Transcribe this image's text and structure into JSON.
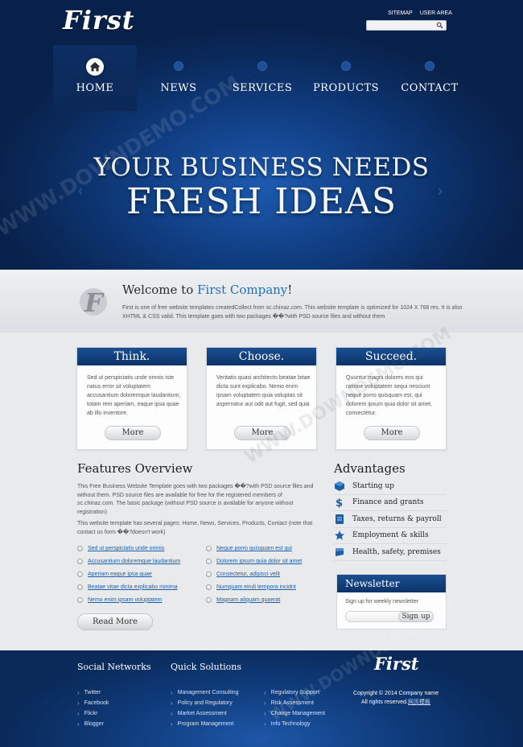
{
  "brand": {
    "logo": "First"
  },
  "toplinks": [
    "SITEMAP",
    "USER AREA"
  ],
  "search": {
    "placeholder": ""
  },
  "nav": [
    {
      "label": "HOME",
      "active": true,
      "icon": "home-icon"
    },
    {
      "label": "NEWS",
      "active": false,
      "icon": "news-icon"
    },
    {
      "label": "SERVICES",
      "active": false,
      "icon": "services-icon"
    },
    {
      "label": "PRODUCTS",
      "active": false,
      "icon": "products-icon"
    },
    {
      "label": "CONTACT",
      "active": false,
      "icon": "contact-icon"
    }
  ],
  "hero": {
    "line1": "YOUR BUSINESS NEEDS",
    "line2": "FRESH IDEAS",
    "prev": "‹",
    "next": "›"
  },
  "welcome": {
    "title_prefix": "Welcome to ",
    "title_accent": "First Company",
    "title_suffix": "!",
    "text": "First is one of free website templates createdCollect from sc.chinaz.com. This website template is optimized for 1024 X 768 res. It is also XHTML & CSS valid. This template goes with two packages ��?with PSD source files and without them"
  },
  "boxes": [
    {
      "title": "Think.",
      "text": "Sed ut perspiciatis unde omnis iste natus error sit voluptatem accusantium doloremque laudantium, totam rem aperiam, eaque ipsa quae ab illo inventore.",
      "button": "More"
    },
    {
      "title": "Choose.",
      "text": "Veritatis quasi architecto beatae bitae dicta sunt explicabo. Nemo enim ipsam voluptatem quia voluptas sit aspernatur aut odit aut fugit, sed quia",
      "button": "More"
    },
    {
      "title": "Succeed.",
      "text": "Quuntur magni dolores eos qui ratione voluptatem sequi nesciunt neque porro quisquam est, qui dolorem ipsum quia dolor sit amet, consectetur.",
      "button": "More"
    }
  ],
  "features": {
    "title": "Features Overview",
    "p1": "This Free Business Website Template goes with two packages ��?with PSD source files and without them. PSD source files are available for free for the registered members of sc.chinaz.com. The basic package (without PSD source is available for anyone without registration)",
    "p2": "This website template has several pages: Home, News, Services, Products, Contact (note that contact us form ��?doesn't work)",
    "list_left": [
      "Sed ut perspiciatis unde omnis",
      "Accusantium doloremque laudantium",
      "Aperiam eaque ipsa quae",
      "Beatae vitae dicta explicabo minima",
      "Nemo enim ipsam voluptatem"
    ],
    "list_right": [
      "Neque porro quisquam est qui",
      "Dolorem ipsum quia dolor sit amet",
      "Consectetur, adipisci velit",
      "Numquam eindi tempora incidnt",
      "Magnam aliquam quaerat"
    ],
    "button": "Read More"
  },
  "advantages": {
    "title": "Advantages",
    "items": [
      {
        "label": "Starting up",
        "icon": "cube-icon"
      },
      {
        "label": "Finance and grants",
        "icon": "dollar-icon"
      },
      {
        "label": "Taxes, returns & payroll",
        "icon": "receipt-icon"
      },
      {
        "label": "Employment & skills",
        "icon": "star-icon"
      },
      {
        "label": "Health, safety, premises",
        "icon": "flag-icon"
      }
    ]
  },
  "newsletter": {
    "title": "Newsletter",
    "text": "Sign up for weekly newsletter",
    "placeholder": "",
    "button": "Sign up"
  },
  "footer": {
    "social_title": "Social Networks",
    "social": [
      "Twitter",
      "Facebook",
      "Flickr",
      "Blogger"
    ],
    "quick_title": "Quick Solutions",
    "quick_col1": [
      "Management Consulting",
      "Policy and Regulatory",
      "Market Assessment",
      "Program Management"
    ],
    "quick_col2": [
      "Regulatory Support",
      "Risk Assessment",
      "Change Management",
      "Info Technology"
    ],
    "logo": "First",
    "copyright": "Copyright © 2014 Company name",
    "rights": "All rights reserved.",
    "rights_link": "网页模板"
  },
  "watermark": "WWW.DOWNDEMO.COM",
  "colors": {
    "header_blue": "#0a2a5c",
    "accent_blue": "#1f6fb8",
    "link_blue": "#1f5fa8",
    "background": "#e9eaec"
  }
}
